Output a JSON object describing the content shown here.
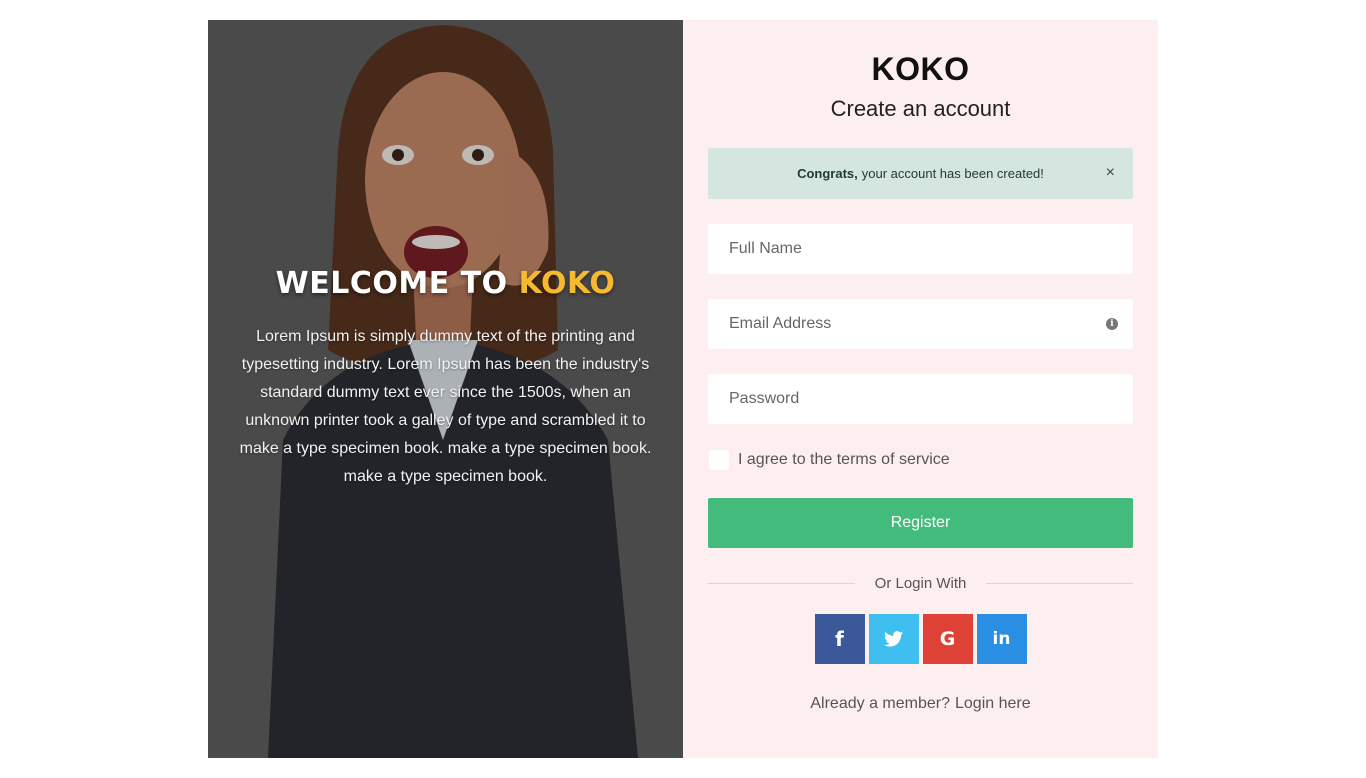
{
  "hero": {
    "title_prefix": "WELCOME TO",
    "title_brand": "KOKO",
    "description": "Lorem Ipsum is simply dummy text of the printing and typesetting industry. Lorem Ipsum has been the industry's standard dummy text ever since the 1500s, when an unknown printer took a galley of type and scrambled it to make a type specimen book. make a type specimen book. make a type specimen book."
  },
  "form": {
    "brand": "KOKO",
    "subtitle": "Create an account",
    "alert": {
      "strong": "Congrats,",
      "message": "your account has been created!",
      "close": "×"
    },
    "full_name": {
      "placeholder": "Full Name",
      "value": ""
    },
    "email": {
      "placeholder": "Email Address",
      "value": ""
    },
    "password": {
      "placeholder": "Password",
      "value": ""
    },
    "terms_label": "I agree to the terms of service",
    "register_label": "Register",
    "divider_text": "Or Login With",
    "member_text": "Already a member?",
    "login_link": "Login here"
  },
  "socials": [
    {
      "name": "facebook",
      "glyph": "f",
      "color": "#3b5998"
    },
    {
      "name": "twitter",
      "glyph": "",
      "color": "#3fbfef"
    },
    {
      "name": "google",
      "glyph": "G",
      "color": "#de4236"
    },
    {
      "name": "linkedin",
      "glyph": "in",
      "color": "#2a8ee3"
    }
  ],
  "colors": {
    "accent_green": "#43bb7d",
    "brand_yellow": "#f6b930",
    "form_bg": "#fdefef",
    "alert_bg": "#d4e6df"
  }
}
